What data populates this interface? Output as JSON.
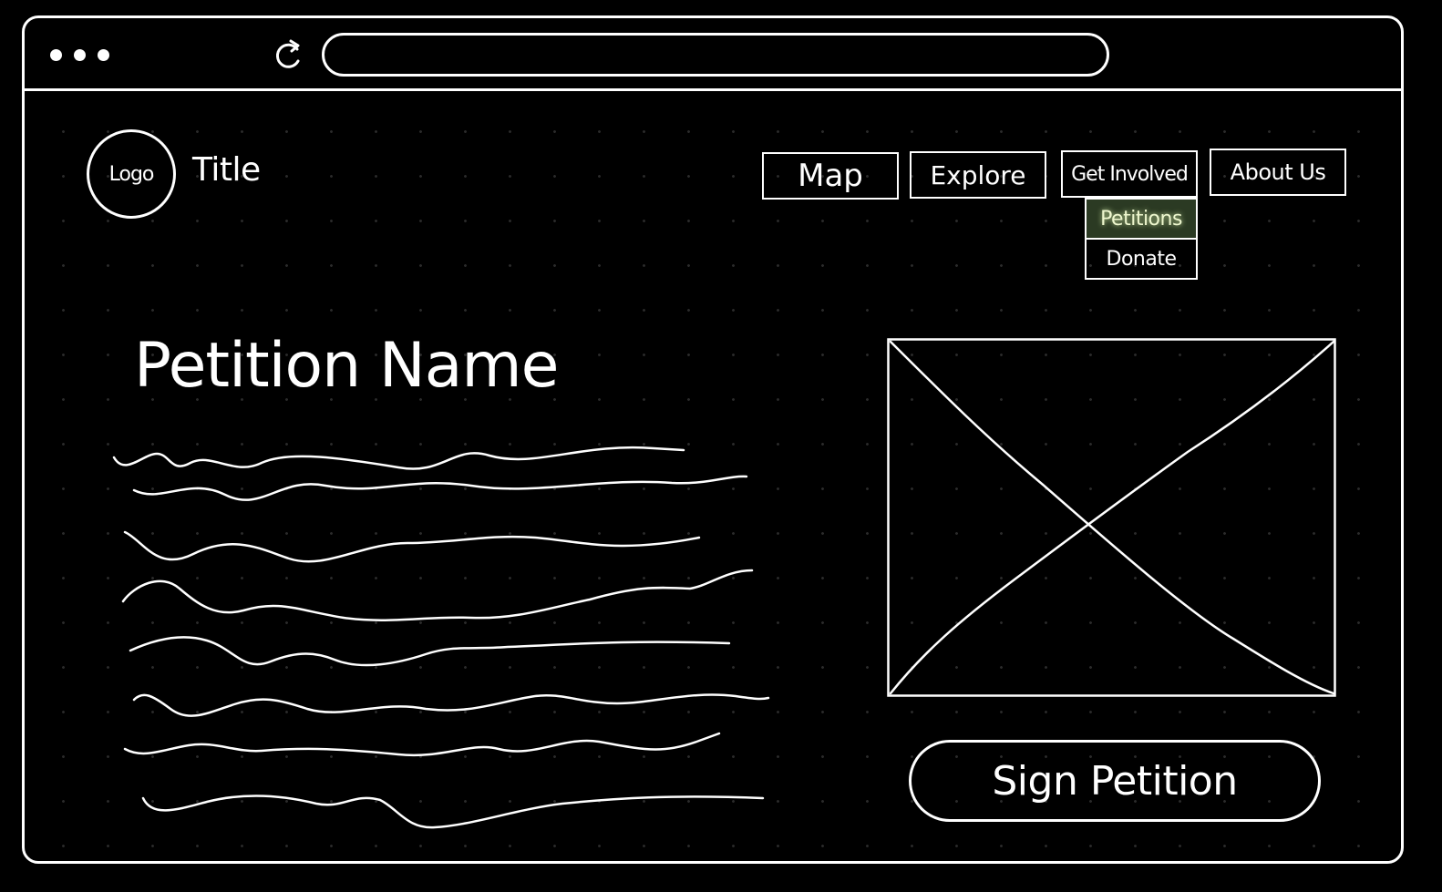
{
  "browser": {
    "address_value": "",
    "controls": [
      "window-dot",
      "window-dot",
      "window-dot"
    ],
    "refresh_icon": "refresh-icon"
  },
  "header": {
    "logo_text": "Logo",
    "title": "Title"
  },
  "nav": {
    "items": [
      {
        "label": "Map"
      },
      {
        "label": "Explore"
      },
      {
        "label": "Get Involved"
      },
      {
        "label": "About Us"
      }
    ],
    "dropdown": [
      {
        "label": "Petitions",
        "highlighted": true
      },
      {
        "label": "Donate",
        "highlighted": false
      }
    ]
  },
  "main": {
    "petition_name": "Petition Name",
    "body_placeholder_lines": 8,
    "image_placeholder": "image-placeholder-icon",
    "sign_button_label": "Sign Petition"
  },
  "colors": {
    "background": "#000000",
    "foreground": "#ffffff",
    "highlight": "#cfe6a3"
  }
}
